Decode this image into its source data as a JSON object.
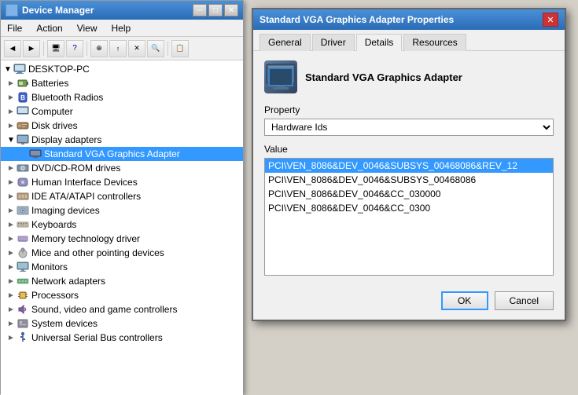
{
  "deviceManager": {
    "title": "Device Manager",
    "menuItems": [
      "File",
      "Action",
      "View",
      "Help"
    ],
    "treeItems": [
      {
        "id": "root",
        "label": "DESKTOP-PC",
        "indent": 0,
        "expanded": true,
        "icon": "computer"
      },
      {
        "id": "batteries",
        "label": "Batteries",
        "indent": 1,
        "icon": "generic"
      },
      {
        "id": "bluetooth",
        "label": "Bluetooth Radios",
        "indent": 1,
        "icon": "bluetooth"
      },
      {
        "id": "computer",
        "label": "Computer",
        "indent": 1,
        "icon": "generic"
      },
      {
        "id": "diskdrives",
        "label": "Disk drives",
        "indent": 1,
        "icon": "disk"
      },
      {
        "id": "displayadapters",
        "label": "Display adapters",
        "indent": 1,
        "expanded": true,
        "icon": "display"
      },
      {
        "id": "vga",
        "label": "Standard VGA Graphics Adapter",
        "indent": 2,
        "icon": "generic",
        "selected": true
      },
      {
        "id": "dvd",
        "label": "DVD/CD-ROM drives",
        "indent": 1,
        "icon": "dvd"
      },
      {
        "id": "hid",
        "label": "Human Interface Devices",
        "indent": 1,
        "icon": "generic"
      },
      {
        "id": "ide",
        "label": "IDE ATA/ATAPI controllers",
        "indent": 1,
        "icon": "ide"
      },
      {
        "id": "imaging",
        "label": "Imaging devices",
        "indent": 1,
        "icon": "generic"
      },
      {
        "id": "keyboards",
        "label": "Keyboards",
        "indent": 1,
        "icon": "keyboard"
      },
      {
        "id": "memory",
        "label": "Memory technology driver",
        "indent": 1,
        "icon": "generic"
      },
      {
        "id": "mice",
        "label": "Mice and other pointing devices",
        "indent": 1,
        "icon": "mouse"
      },
      {
        "id": "monitors",
        "label": "Monitors",
        "indent": 1,
        "icon": "monitor"
      },
      {
        "id": "network",
        "label": "Network adapters",
        "indent": 1,
        "icon": "network"
      },
      {
        "id": "processors",
        "label": "Processors",
        "indent": 1,
        "icon": "processor"
      },
      {
        "id": "sound",
        "label": "Sound, video and game controllers",
        "indent": 1,
        "icon": "sound"
      },
      {
        "id": "system",
        "label": "System devices",
        "indent": 1,
        "icon": "generic"
      },
      {
        "id": "usb",
        "label": "Universal Serial Bus controllers",
        "indent": 1,
        "icon": "usb"
      }
    ]
  },
  "propertiesDialog": {
    "title": "Standard VGA Graphics Adapter Properties",
    "deviceName": "Standard VGA Graphics Adapter",
    "tabs": [
      "General",
      "Driver",
      "Details",
      "Resources"
    ],
    "activeTab": "Details",
    "propertyLabel": "Property",
    "propertyValue": "Hardware Ids",
    "valueLabel": "Value",
    "valueItems": [
      {
        "id": 1,
        "text": "PCI\\VEN_8086&DEV_0046&SUBSYS_00468086&REV_12",
        "selected": true
      },
      {
        "id": 2,
        "text": "PCI\\VEN_8086&DEV_0046&SUBSYS_00468086",
        "selected": false
      },
      {
        "id": 3,
        "text": "PCI\\VEN_8086&DEV_0046&CC_030000",
        "selected": false
      },
      {
        "id": 4,
        "text": "PCI\\VEN_8086&DEV_0046&CC_0300",
        "selected": false
      }
    ],
    "okLabel": "OK",
    "cancelLabel": "Cancel"
  },
  "toolbar": {
    "buttons": [
      "←",
      "→",
      "⊞",
      "?",
      "⚙",
      "↻",
      "✕",
      "↑",
      "↓",
      "⊕"
    ]
  }
}
